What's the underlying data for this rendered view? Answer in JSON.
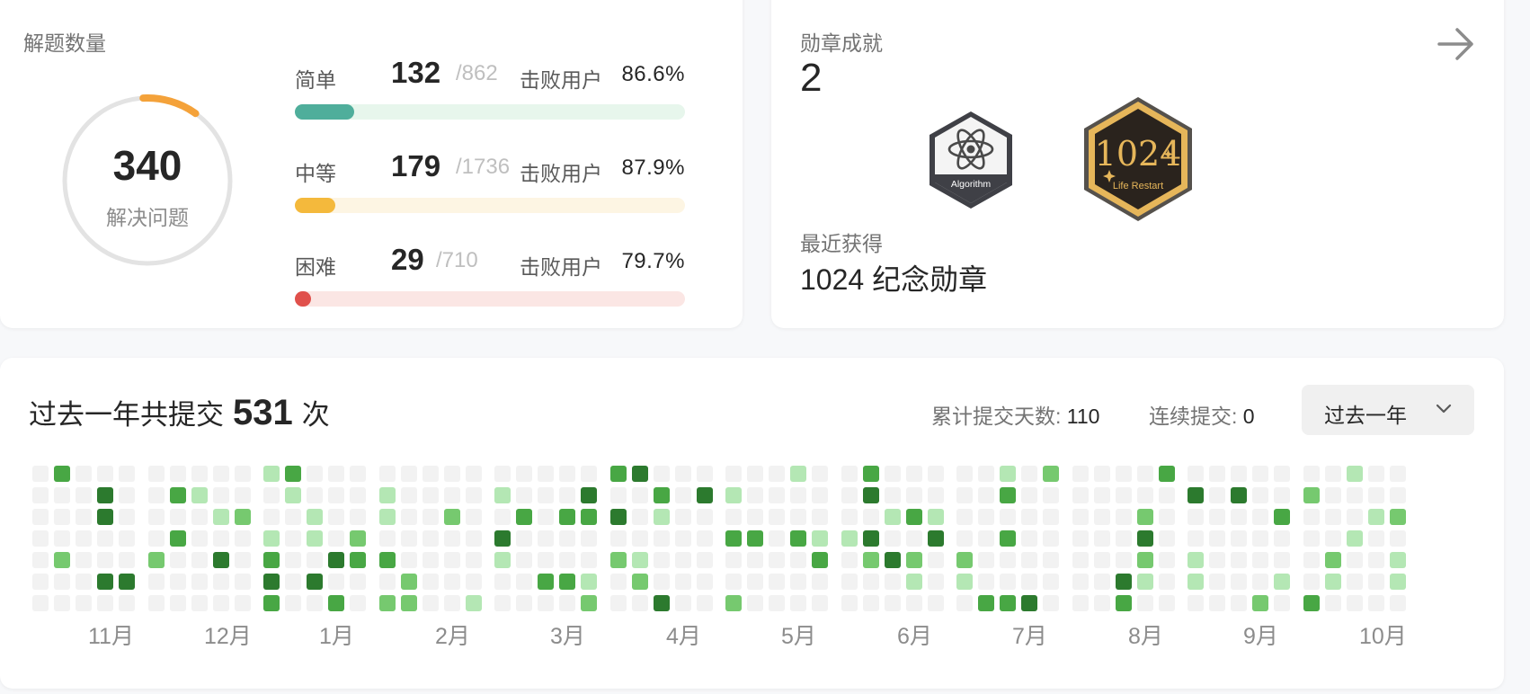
{
  "solved_card": {
    "title": "解题数量",
    "total_solved": "340",
    "total_label": "解决问题",
    "difficulties": [
      {
        "name": "简单",
        "solved": "132",
        "total": "/862",
        "beat_label": "击败用户",
        "beat_pct": "86.6%",
        "progress": 0.153,
        "color": "#4fae9b",
        "track": "#e7f6ec"
      },
      {
        "name": "中等",
        "solved": "179",
        "total": "/1736",
        "beat_label": "击败用户",
        "beat_pct": "87.9%",
        "progress": 0.103,
        "color": "#f4b93c",
        "track": "#fdf5e3"
      },
      {
        "name": "困难",
        "solved": "29",
        "total": "/710",
        "beat_label": "击败用户",
        "beat_pct": "79.7%",
        "progress": 0.041,
        "color": "#e0504b",
        "track": "#fbe6e4"
      }
    ]
  },
  "badge_card": {
    "title": "勋章成就",
    "count": "2",
    "badges": [
      {
        "name": "algorithm-badge",
        "label": "Algorithm"
      },
      {
        "name": "life-restart-badge",
        "label": "Life Restart",
        "logo_text": "1024"
      }
    ],
    "recent_label": "最近获得",
    "recent_name": "1024 纪念勋章",
    "arrow_icon": "arrow-right-icon"
  },
  "heatmap_card": {
    "title_prefix": "过去一年共提交",
    "total_submissions": "531",
    "title_suffix": "次",
    "total_days_label": "累计提交天数:",
    "total_days": "110",
    "streak_label": "连续提交:",
    "streak": "0",
    "range_select": "过去一年",
    "months": [
      "11月",
      "12月",
      "1月",
      "2月",
      "3月",
      "4月",
      "5月",
      "6月",
      "7月",
      "8月",
      "9月",
      "10月"
    ],
    "colors": {
      "empty": "#f2f2f2",
      "level1": "#b4e7b4",
      "level2": "#76c96f",
      "level3": "#48a744",
      "level4": "#2c7a2e"
    }
  }
}
